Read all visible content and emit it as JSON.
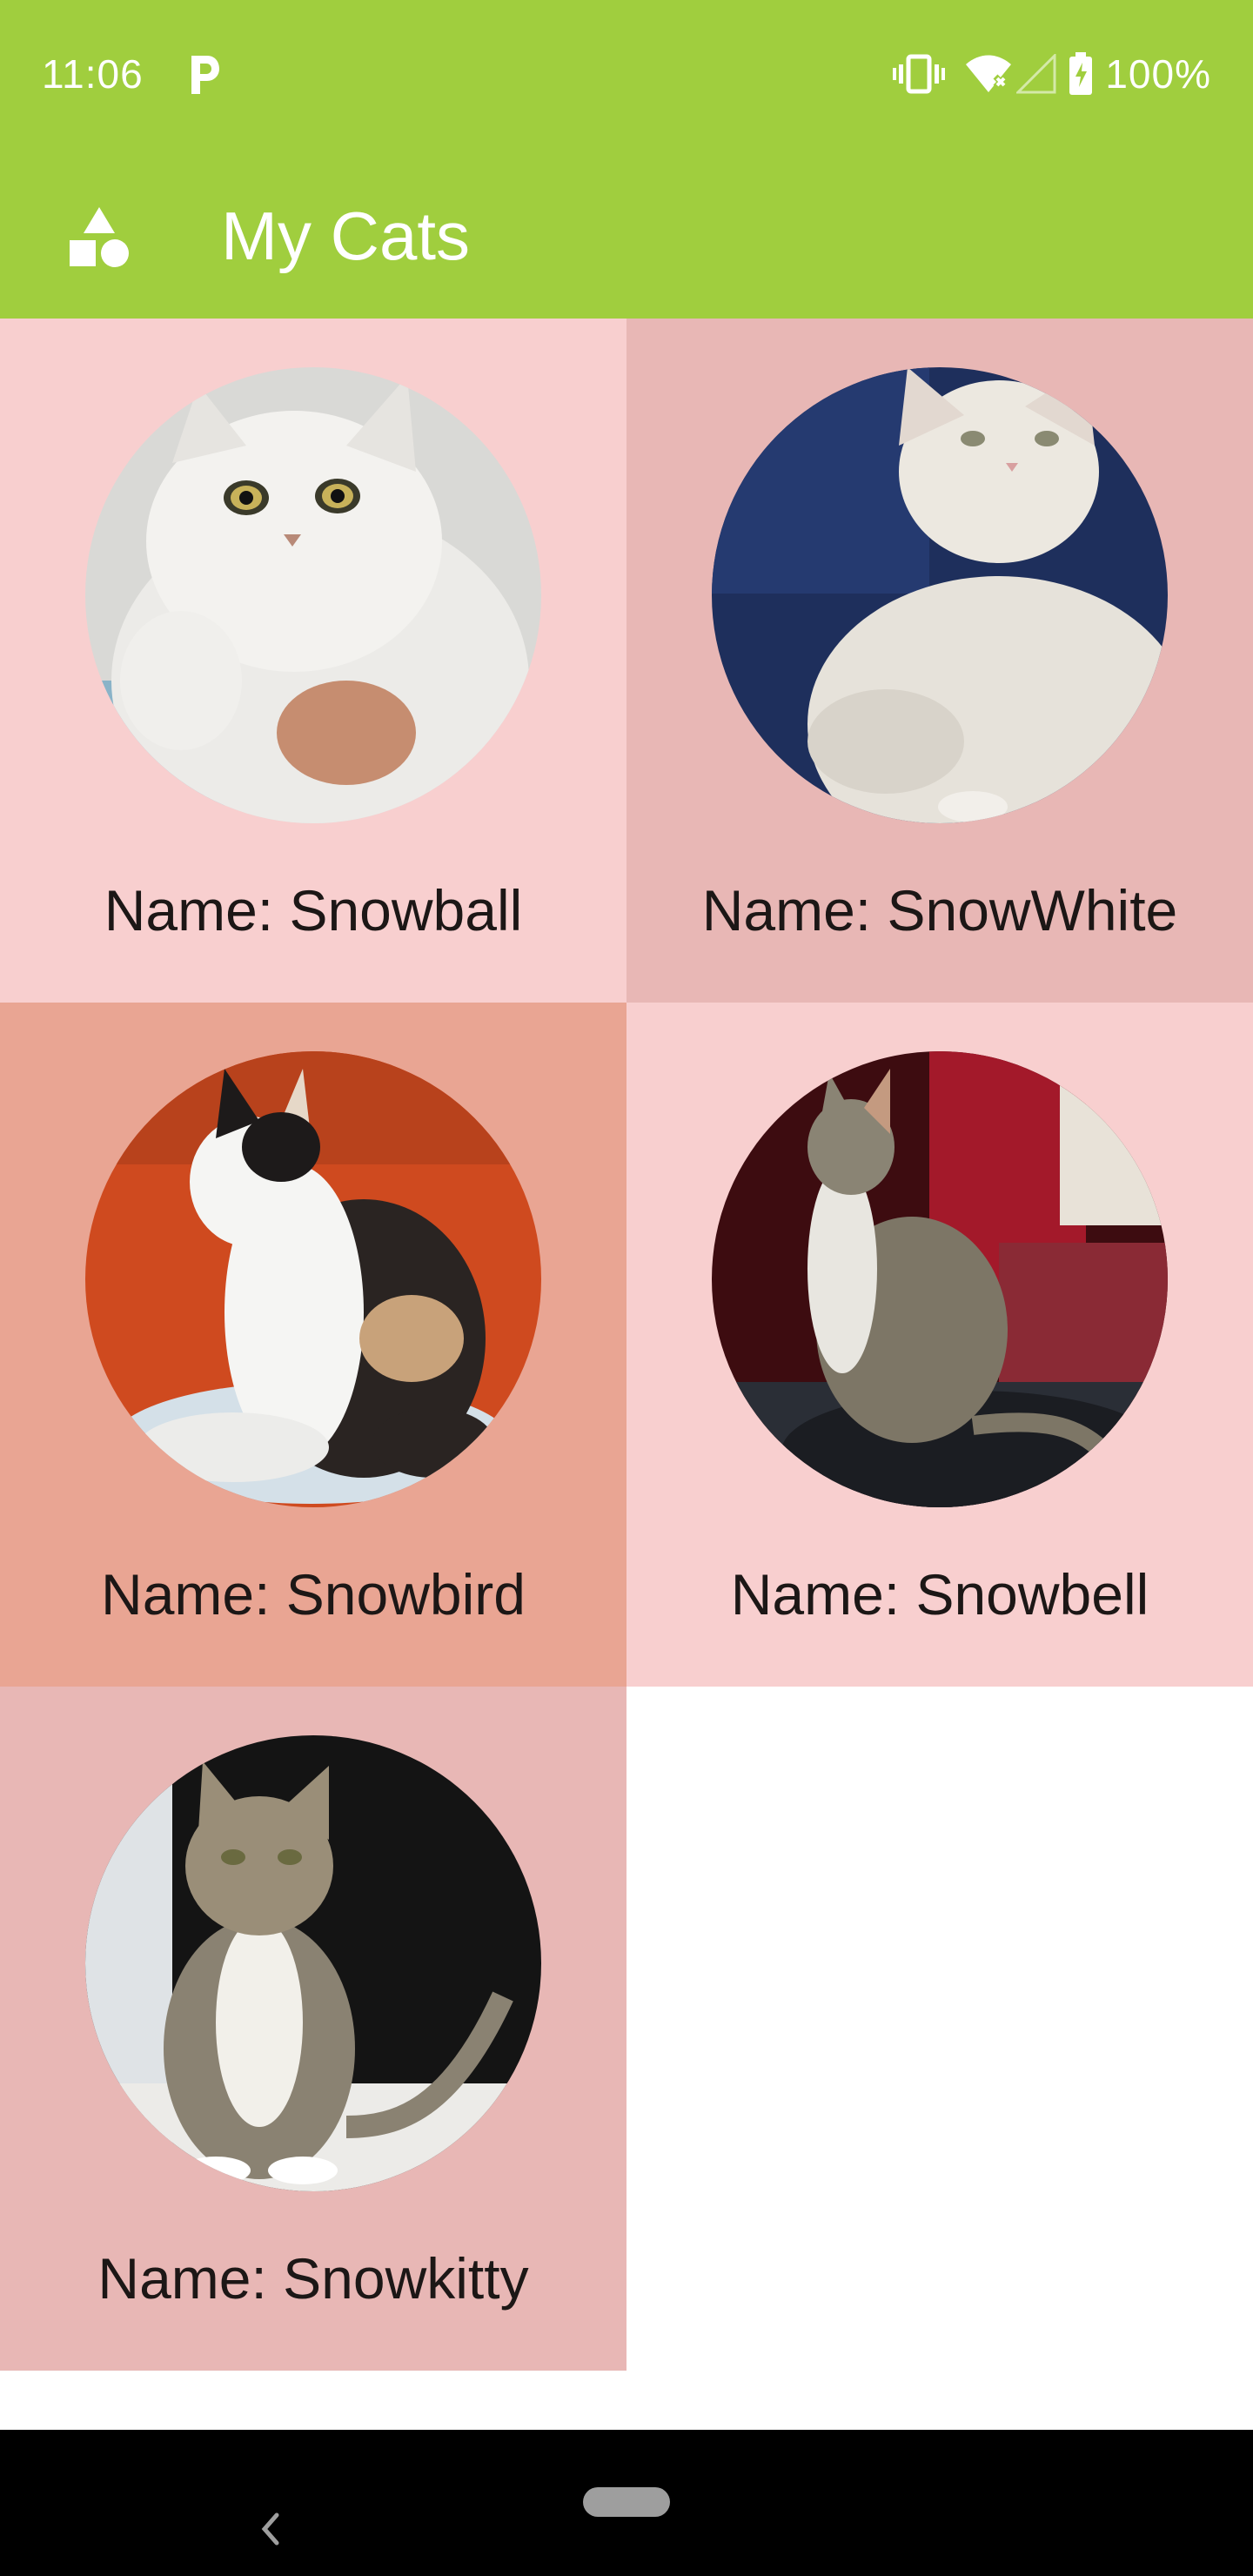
{
  "status_bar": {
    "time": "11:06",
    "battery": "100%",
    "icons": [
      "parking-icon",
      "vibrate-icon",
      "wifi-off-icon",
      "cell-signal-icon",
      "battery-charging-icon"
    ]
  },
  "app_bar": {
    "title": "My Cats",
    "icon": "shapes-icon",
    "color": "#a0ce3e"
  },
  "cats": [
    {
      "name": "Name: Snowball",
      "bg": "#f8cfcf"
    },
    {
      "name": "Name: SnowWhite",
      "bg": "#e8b7b5"
    },
    {
      "name": "Name: Snowbird",
      "bg": "#e9a593"
    },
    {
      "name": "Name: Snowbell",
      "bg": "#f8cfcf"
    },
    {
      "name": "Name: Snowkitty",
      "bg": "#e8b7b5"
    }
  ],
  "nav_bar": {
    "icons": [
      "back-chevron-icon",
      "home-pill-icon"
    ]
  }
}
